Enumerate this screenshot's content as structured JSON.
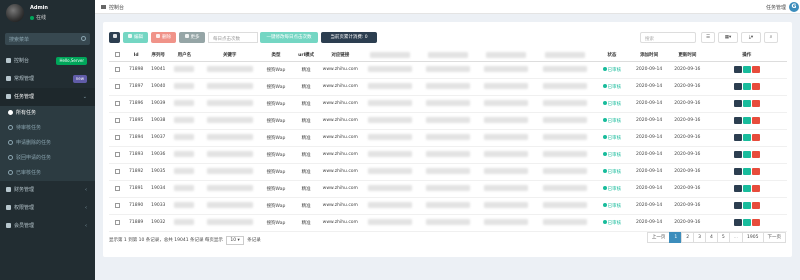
{
  "user": {
    "name": "Admin",
    "status": "在线"
  },
  "sidebar": {
    "search_placeholder": "搜索菜单",
    "items": [
      {
        "label": "控制台",
        "badge": "Hello,Server",
        "badge_color": "#00a65a"
      },
      {
        "label": "常规管理",
        "badge": "new",
        "badge_color": "#605ca8"
      },
      {
        "label": "任务管理",
        "arrow": "⌄"
      }
    ],
    "sub_items": [
      {
        "label": "所有任务",
        "active": true
      },
      {
        "label": "待审核任务"
      },
      {
        "label": "申请删除的任务"
      },
      {
        "label": "驳回申请的任务"
      },
      {
        "label": "已审核任务"
      }
    ],
    "items_after": [
      {
        "label": "财务管理",
        "arrow": "‹"
      },
      {
        "label": "权限管理",
        "arrow": "‹"
      },
      {
        "label": "会员管理",
        "arrow": "‹"
      }
    ]
  },
  "topbar": {
    "breadcrumb": "控制台",
    "right_link": "任务管理"
  },
  "toolbar": {
    "refresh_icon": "refresh-icon",
    "edit_label": "编辑",
    "delete_label": "删除",
    "more_label": "更多",
    "limit_placeholder": "每日点击次数",
    "set_limit_label": "一键修改每日点击次数",
    "page_count_label": "当前页累计消费: 0",
    "search_placeholder": "搜索",
    "colors": {
      "primary": "#2c3e50",
      "success": "#18bc9c",
      "danger": "#e74c3c",
      "info": "#95a5a6"
    }
  },
  "table": {
    "headers": [
      "",
      "Id",
      "序列号",
      "用户名",
      "关键字",
      "类型",
      "url模式",
      "对应链接",
      "",
      "",
      "",
      "",
      "状态",
      "添加时间",
      "更新时间",
      "操作"
    ],
    "rows": [
      {
        "id": "71898",
        "serial": "19041",
        "type": "搜狗Wap",
        "mode": "精准",
        "url": "www.zhihu.com",
        "status": "已审核",
        "added": "2020-09-14",
        "updated": "2020-09-16"
      },
      {
        "id": "71897",
        "serial": "19040",
        "type": "搜狗Wap",
        "mode": "精准",
        "url": "www.zhihu.com",
        "status": "已审核",
        "added": "2020-09-14",
        "updated": "2020-09-16"
      },
      {
        "id": "71896",
        "serial": "19039",
        "type": "搜狗Wap",
        "mode": "精准",
        "url": "www.zhihu.com",
        "status": "已审核",
        "added": "2020-09-14",
        "updated": "2020-09-16"
      },
      {
        "id": "71895",
        "serial": "19038",
        "type": "搜狗Wap",
        "mode": "精准",
        "url": "www.zhihu.com",
        "status": "已审核",
        "added": "2020-09-14",
        "updated": "2020-09-16"
      },
      {
        "id": "71894",
        "serial": "19037",
        "type": "搜狗Wap",
        "mode": "精准",
        "url": "www.zhihu.com",
        "status": "已审核",
        "added": "2020-09-14",
        "updated": "2020-09-16"
      },
      {
        "id": "71893",
        "serial": "19036",
        "type": "搜狗Wap",
        "mode": "精准",
        "url": "www.zhihu.com",
        "status": "已审核",
        "added": "2020-09-14",
        "updated": "2020-09-16"
      },
      {
        "id": "71892",
        "serial": "19035",
        "type": "搜狗Wap",
        "mode": "精准",
        "url": "www.zhihu.com",
        "status": "已审核",
        "added": "2020-09-14",
        "updated": "2020-09-16"
      },
      {
        "id": "71891",
        "serial": "19034",
        "type": "搜狗Wap",
        "mode": "精准",
        "url": "www.zhihu.com",
        "status": "已审核",
        "added": "2020-09-14",
        "updated": "2020-09-16"
      },
      {
        "id": "71890",
        "serial": "19033",
        "type": "搜狗Wap",
        "mode": "精准",
        "url": "www.zhihu.com",
        "status": "已审核",
        "added": "2020-09-14",
        "updated": "2020-09-16"
      },
      {
        "id": "71889",
        "serial": "19032",
        "type": "搜狗Wap",
        "mode": "精准",
        "url": "www.zhihu.com",
        "status": "已审核",
        "added": "2020-09-14",
        "updated": "2020-09-16"
      }
    ]
  },
  "footer": {
    "info_prefix": "显示第 1 到第 10 条记录，总共 19041 条记录 每页显示",
    "page_size": "10",
    "info_suffix": "条记录",
    "pages": [
      "上一页",
      "1",
      "2",
      "3",
      "4",
      "5",
      "...",
      "1905",
      "下一页"
    ]
  }
}
